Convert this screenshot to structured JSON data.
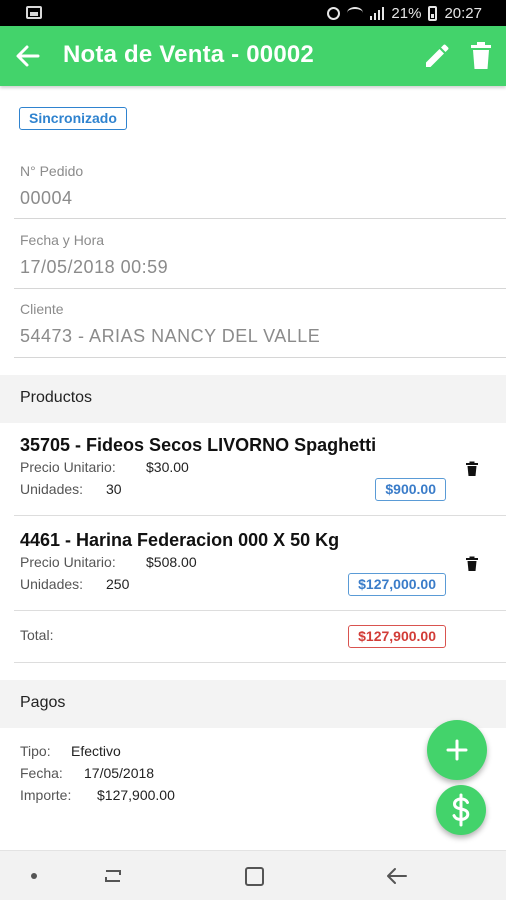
{
  "status_bar": {
    "battery": "21%",
    "time": "20:27"
  },
  "app_bar": {
    "title": "Nota de Venta - 00002",
    "back_icon": "arrow-back-icon",
    "edit_icon": "pencil-icon",
    "delete_icon": "trash-icon"
  },
  "sync_status": "Sincronizado",
  "order": {
    "number_label": "N° Pedido",
    "number": "00004",
    "datetime_label": "Fecha y Hora",
    "datetime": "17/05/2018 00:59",
    "client_label": "Cliente",
    "client": "54473 - ARIAS NANCY DEL VALLE"
  },
  "products": {
    "section_title": "Productos",
    "items": [
      {
        "name": "35705 - Fideos Secos LIVORNO Spaghetti",
        "unit_price_label": "Precio Unitario:",
        "unit_price": "$30.00",
        "units_label": "Unidades:",
        "units": "30",
        "subtotal": "$900.00"
      },
      {
        "name": "4461 - Harina Federacion 000 X 50 Kg",
        "unit_price_label": "Precio Unitario:",
        "unit_price": "$508.00",
        "units_label": "Unidades:",
        "units": "250",
        "subtotal": "$127,000.00"
      }
    ],
    "total_label": "Total:",
    "total": "$127,900.00"
  },
  "payments": {
    "section_title": "Pagos",
    "type_label": "Tipo:",
    "type": "Efectivo",
    "date_label": "Fecha:",
    "date": "17/05/2018",
    "amount_label": "Importe:",
    "amount": "$127,900.00"
  },
  "fab": {
    "add_label": "+",
    "pay_label": "$"
  },
  "colors": {
    "primary": "#43d36b",
    "badge_blue": "#2f83cf",
    "badge_red": "#d9534f"
  }
}
